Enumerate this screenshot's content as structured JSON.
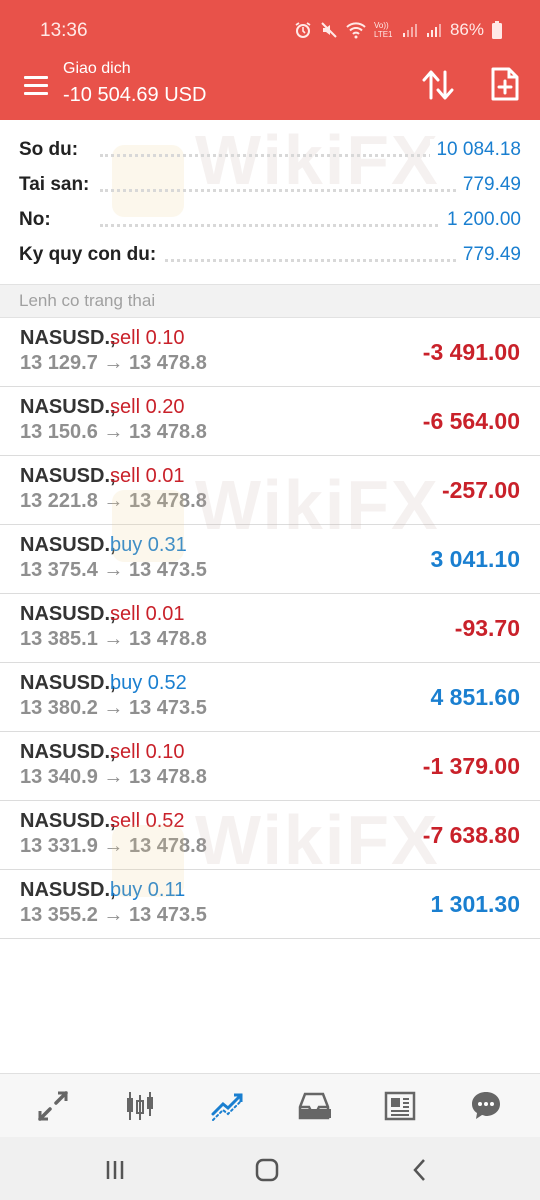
{
  "status_bar": {
    "time": "13:36",
    "battery": "86%",
    "icons": [
      "alarm-icon",
      "mute-icon",
      "wifi-icon",
      "volte-icon",
      "signal-icon",
      "signal-icon",
      "battery-icon"
    ],
    "volte_text": "Vo)) LTE1"
  },
  "header": {
    "title": "Giao dich",
    "balance_line": "-10 504.69 USD",
    "color": "#e8524a"
  },
  "summary": [
    {
      "label": "So du:",
      "value": "10 084.18"
    },
    {
      "label": "Tai san:",
      "value": "779.49"
    },
    {
      "label": "No:",
      "value": "1 200.00"
    },
    {
      "label": "Ky quy con du:",
      "value": "779.49"
    }
  ],
  "section_title": "Lenh co trang thai",
  "positions": [
    {
      "symbol": "NASUSD.,",
      "side": "sell 0.10",
      "type": "sell",
      "prices": "13 129.7 → 13 478.8",
      "profit": "-3 491.00"
    },
    {
      "symbol": "NASUSD.,",
      "side": "sell 0.20",
      "type": "sell",
      "prices": "13 150.6 → 13 478.8",
      "profit": "-6 564.00"
    },
    {
      "symbol": "NASUSD.,",
      "side": "sell 0.01",
      "type": "sell",
      "prices": "13 221.8 → 13 478.8",
      "profit": "-257.00"
    },
    {
      "symbol": "NASUSD.,",
      "side": "buy 0.31",
      "type": "buy",
      "prices": "13 375.4 → 13 473.5",
      "profit": "3 041.10"
    },
    {
      "symbol": "NASUSD.,",
      "side": "sell 0.01",
      "type": "sell",
      "prices": "13 385.1 → 13 478.8",
      "profit": "-93.70"
    },
    {
      "symbol": "NASUSD.,",
      "side": "buy 0.52",
      "type": "buy",
      "prices": "13 380.2 → 13 473.5",
      "profit": "4 851.60"
    },
    {
      "symbol": "NASUSD.,",
      "side": "sell 0.10",
      "type": "sell",
      "prices": "13 340.9 → 13 478.8",
      "profit": "-1 379.00"
    },
    {
      "symbol": "NASUSD.,",
      "side": "sell 0.52",
      "type": "sell",
      "prices": "13 331.9 → 13 478.8",
      "profit": "-7 638.80"
    },
    {
      "symbol": "NASUSD.,",
      "side": "buy 0.11",
      "type": "buy",
      "prices": "13 355.2 → 13 473.5",
      "profit": "1 301.30"
    }
  ],
  "watermark": "WikiFX",
  "bottom_nav": [
    "trade-arrows-icon",
    "candlestick-chart-icon",
    "trade-chart-icon",
    "inbox-icon",
    "news-icon",
    "chat-icon"
  ],
  "colors": {
    "sell": "#c9212a",
    "buy": "#1a7fd0",
    "active_nav": "#1a7fd0"
  }
}
